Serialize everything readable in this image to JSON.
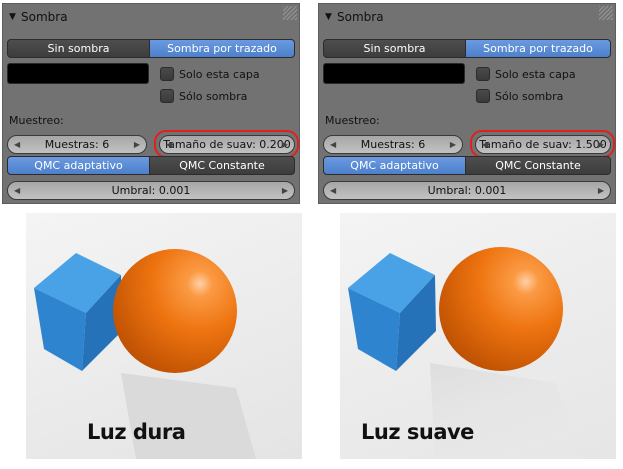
{
  "panels": [
    {
      "title": "Sombra",
      "shadow_off_label": "Sin sombra",
      "shadow_trace_label": "Sombra por trazado",
      "only_layer_label": "Solo esta capa",
      "only_shadow_label": "Sólo sombra",
      "sampling_label": "Muestreo:",
      "samples_value": "Muestras: 6",
      "soft_size_value": "Tamaño de suav: 0.200",
      "qmc_adaptive_label": "QMC adaptativo",
      "qmc_constant_label": "QMC Constante",
      "threshold_value": "Umbral: 0.001"
    },
    {
      "title": "Sombra",
      "shadow_off_label": "Sin sombra",
      "shadow_trace_label": "Sombra por trazado",
      "only_layer_label": "Solo esta capa",
      "only_shadow_label": "Sólo sombra",
      "sampling_label": "Muestreo:",
      "samples_value": "Muestras: 6",
      "soft_size_value": "Tamaño de suav: 1.500",
      "qmc_adaptive_label": "QMC adaptativo",
      "qmc_constant_label": "QMC Constante",
      "threshold_value": "Umbral: 0.001"
    }
  ],
  "renders": [
    {
      "caption": "Luz dura"
    },
    {
      "caption": "Luz suave"
    }
  ],
  "colors": {
    "panel_bg": "#727272",
    "active_button": "#5a8bd6",
    "highlight_ring": "#e0201c",
    "sphere": "#f07410",
    "cube": "#3d8fd6"
  }
}
